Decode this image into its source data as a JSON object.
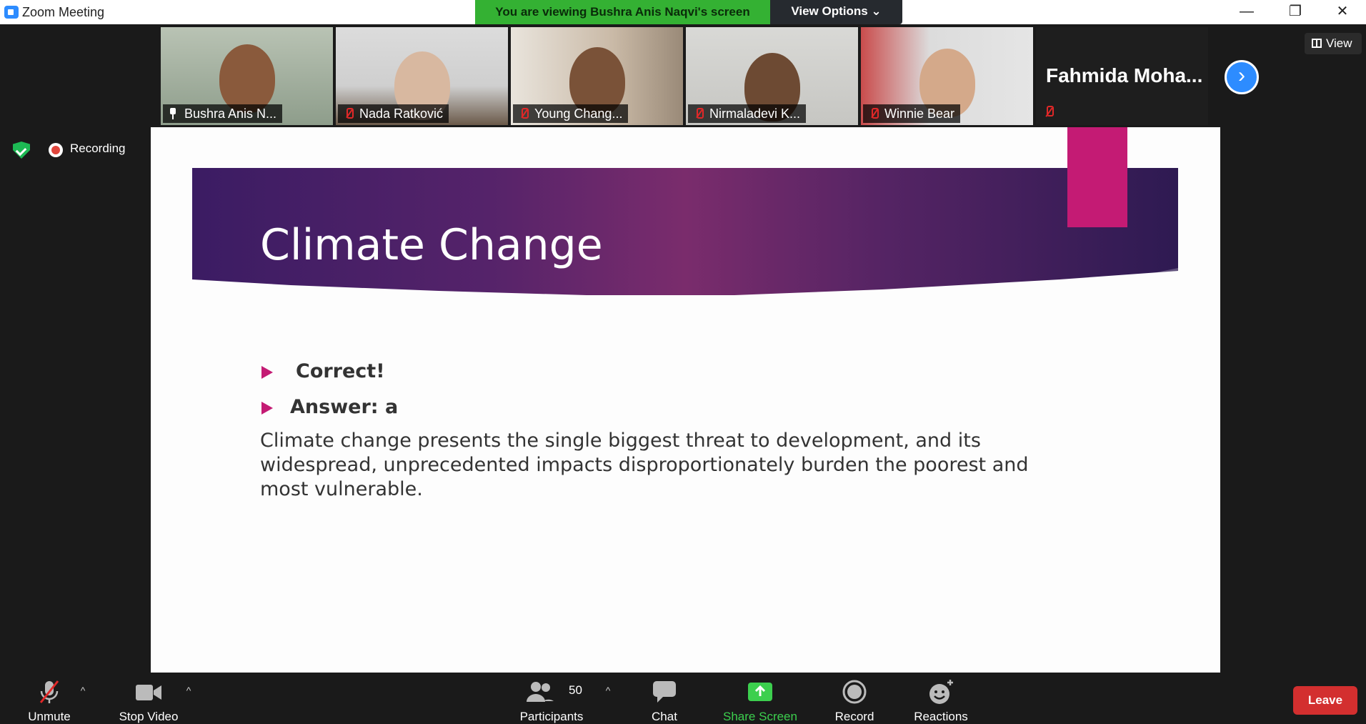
{
  "window": {
    "title": "Zoom Meeting",
    "viewing_banner": "You are viewing Bushra Anis Naqvi's screen",
    "view_options": "View Options ⌄",
    "minimize": "—",
    "restore": "❐",
    "close": "✕"
  },
  "gallery": {
    "participants": [
      {
        "name": "Bushra Anis N...",
        "pinned": true,
        "muted": false
      },
      {
        "name": "Nada Ratković",
        "muted": true
      },
      {
        "name": "Young Chang...",
        "muted": true
      },
      {
        "name": "Nirmaladevi K...",
        "muted": true
      },
      {
        "name": "Winnie Bear",
        "muted": true
      },
      {
        "name": "Fahmida  Moha...",
        "muted": true,
        "video_off": true
      }
    ],
    "next_label": "›",
    "view_label": "View"
  },
  "recording": {
    "label": "Recording"
  },
  "slide": {
    "title": "Climate Change",
    "bullets": [
      "Correct!",
      "Answer: a"
    ],
    "body": "Climate change presents the single biggest threat to development, and its widespread, unprecedented impacts disproportionately burden the poorest and most vulnerable."
  },
  "toolbar": {
    "unmute": "Unmute",
    "stop_video": "Stop Video",
    "participants": "Participants",
    "participants_count": "50",
    "chat": "Chat",
    "share_screen": "Share Screen",
    "record": "Record",
    "reactions": "Reactions",
    "leave": "Leave",
    "caret": "^"
  },
  "colors": {
    "banner_green": "#34b133",
    "accent_magenta": "#c41b74",
    "zoom_blue": "#2d8cff",
    "leave_red": "#d32f2f"
  }
}
